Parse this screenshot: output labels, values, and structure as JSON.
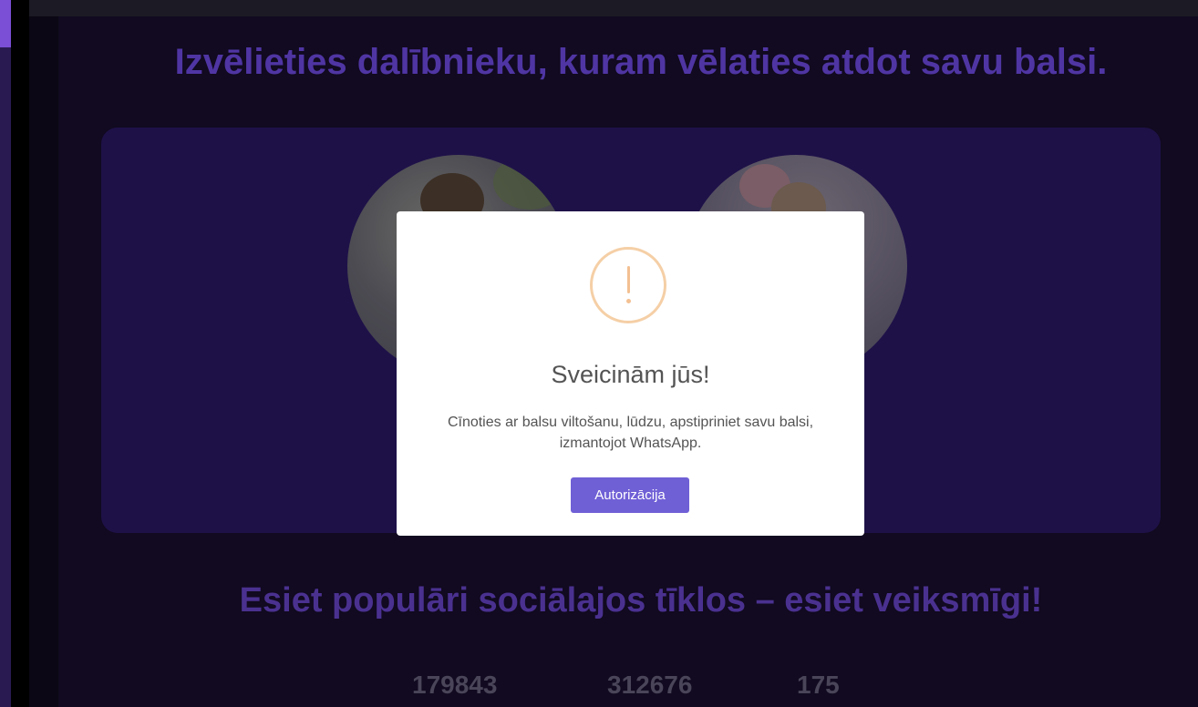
{
  "page": {
    "headline": "Izvēlieties dalībnieku, kuram vēlaties atdot savu balsi.",
    "section_title": "Esiet populāri sociālajos tīklos – esiet veiksmīgi!",
    "stats": [
      "179843",
      "312676",
      "175"
    ]
  },
  "modal": {
    "icon": "exclamation-circle-icon",
    "title": "Sveicinām jūs!",
    "text": "Cīnoties ar balsu viltošanu, lūdzu, apstipriniet savu balsi, izmantojot WhatsApp.",
    "button_label": "Autorizācija"
  },
  "colors": {
    "headline": "#4f35a3",
    "card": "#1e1148",
    "button": "#7060d6",
    "warning": "#f5cfa6"
  }
}
